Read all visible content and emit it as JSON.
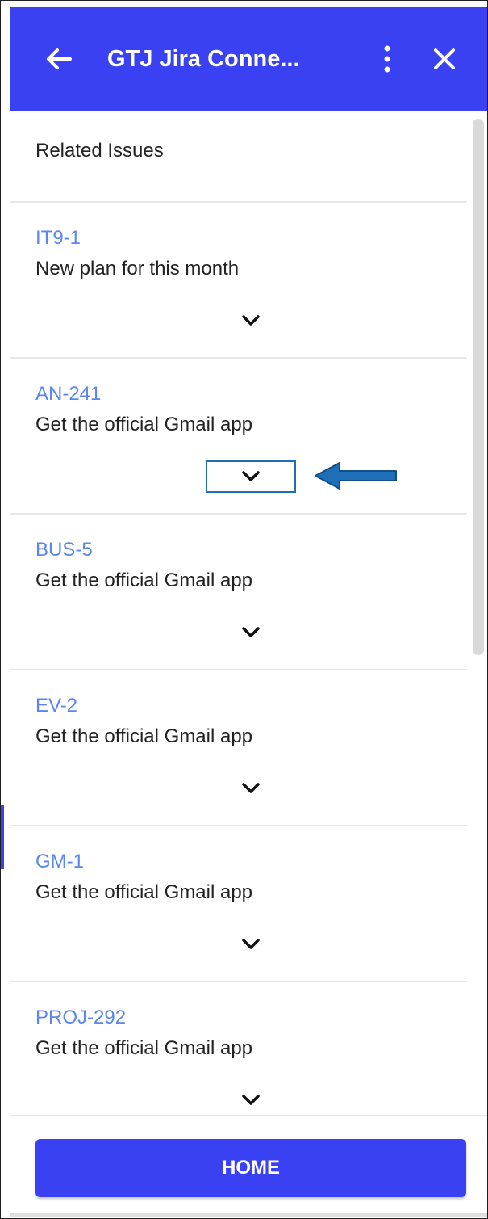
{
  "header": {
    "title": "GTJ Jira Conne...",
    "icons": {
      "back": "arrow-left-icon",
      "menu": "more-vertical-icon",
      "close": "close-icon"
    },
    "color": "#3a41f2"
  },
  "section": {
    "title": "Related Issues"
  },
  "issues": [
    {
      "key": "IT9-1",
      "summary": "New plan for this month"
    },
    {
      "key": "AN-241",
      "summary": "Get the official Gmail app"
    },
    {
      "key": "BUS-5",
      "summary": "Get the official Gmail app"
    },
    {
      "key": "EV-2",
      "summary": "Get the official Gmail app"
    },
    {
      "key": "GM-1",
      "summary": "Get the official Gmail app"
    },
    {
      "key": "PROJ-292",
      "summary": "Get the official Gmail app"
    }
  ],
  "footer": {
    "home_label": "HOME"
  },
  "colors": {
    "accent": "#3a41f2",
    "link": "#5b86f0",
    "annotation": "#1e6fb8"
  }
}
